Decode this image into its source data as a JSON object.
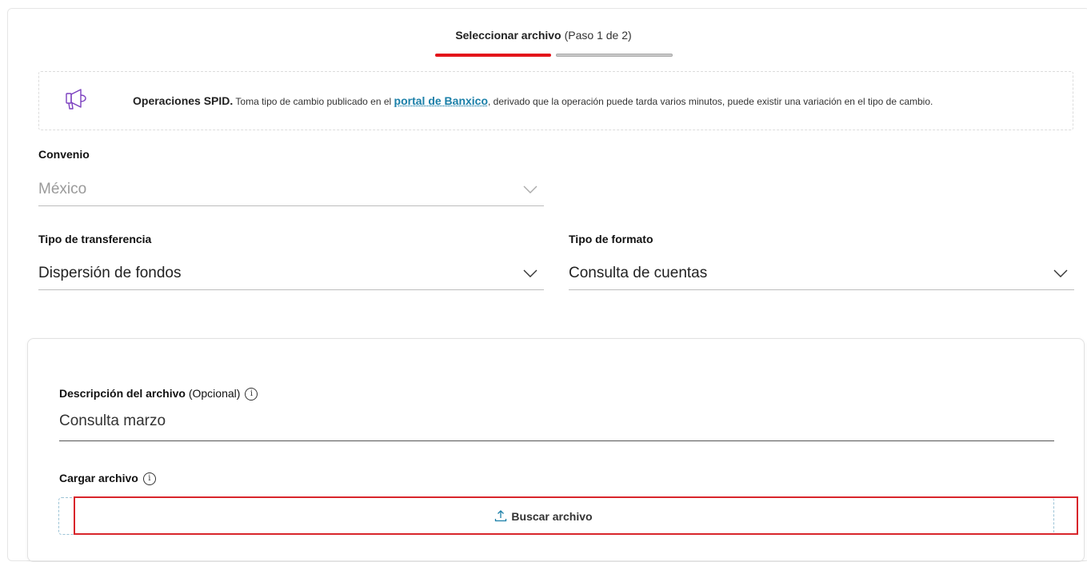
{
  "stepper": {
    "title": "Seleccionar archivo",
    "step": "(Paso 1 de 2)",
    "progress": 0.5
  },
  "notice": {
    "icon": "megaphone-icon",
    "bold": "Operaciones SPID.",
    "text_before": "Toma tipo de cambio publicado en el",
    "link": "portal de Banxico",
    "text_after": ", derivado que la operación puede tarda varios minutos, puede existir una variación en el tipo de cambio."
  },
  "form": {
    "convenio": {
      "label": "Convenio",
      "value": "México"
    },
    "tipo_transferencia": {
      "label": "Tipo de transferencia",
      "value": "Dispersión de fondos"
    },
    "tipo_formato": {
      "label": "Tipo de formato",
      "value": "Consulta de cuentas"
    }
  },
  "upload": {
    "desc_label": "Descripción del archivo",
    "desc_optional": "(Opcional)",
    "desc_value": "Consulta marzo",
    "file_label": "Cargar archivo",
    "button": "Buscar archivo"
  },
  "colors": {
    "accent": "#e3141a",
    "link": "#1a7fa8",
    "icon": "#7b3fbf"
  }
}
